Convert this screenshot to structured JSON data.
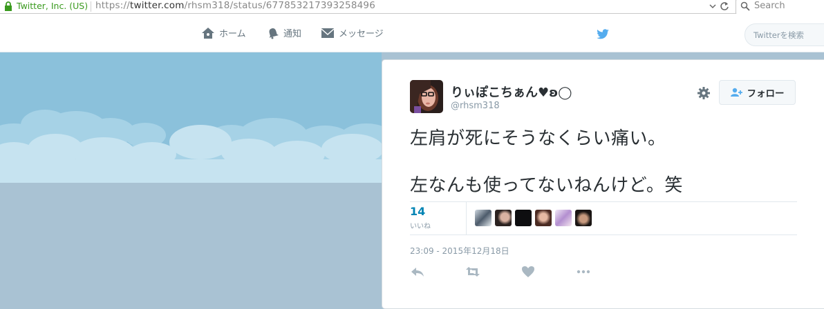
{
  "browser": {
    "site_identity": "Twitter, Inc. (US)",
    "url_prefix": "https://",
    "url_domain": "twitter.com",
    "url_path": "/rhsm318/status/677853217393258496",
    "search_placeholder": "Search"
  },
  "nav": {
    "home": "ホーム",
    "notifications": "通知",
    "messages": "メッセージ",
    "search_placeholder": "Twitterを検索"
  },
  "tweet": {
    "display_name": "りぃぽこちぁん♥︎ʚ◯",
    "handle": "@rhsm318",
    "follow_label": "フォロー",
    "text_line1": "左肩が死にそうなくらい痛い。",
    "text_line2": "左なんも使ってないねんけど。笑",
    "likes_count": "14",
    "likes_label": "いいね",
    "timestamp": "23:09 - 2015年12月18日"
  },
  "colors": {
    "twitter_blue": "#55acee",
    "link_blue": "#0084b4",
    "sky": "#8bc1db",
    "ground": "#a9c2d3"
  }
}
